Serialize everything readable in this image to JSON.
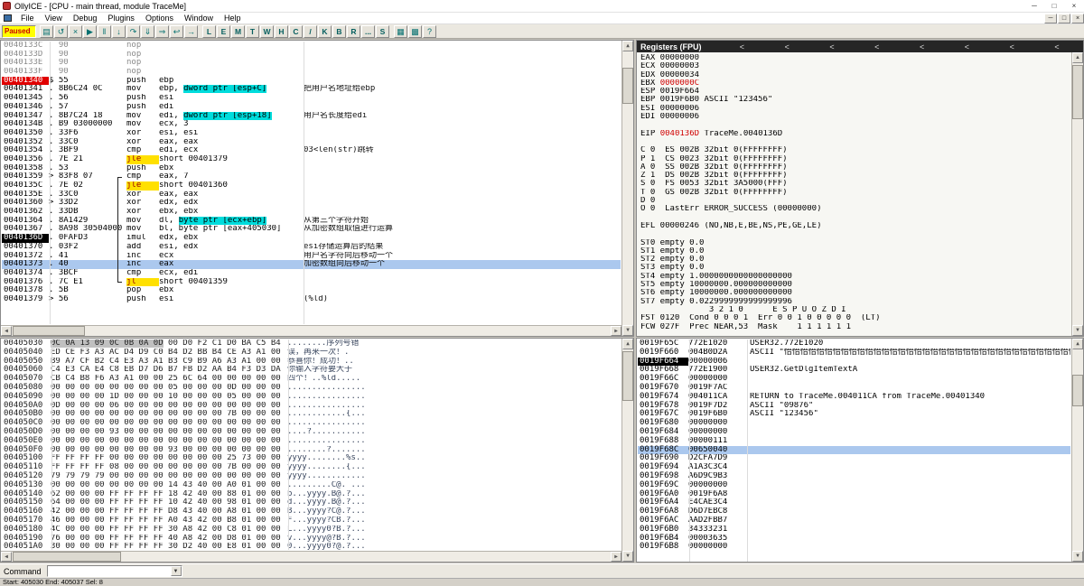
{
  "window": {
    "title": "OllyICE - [CPU - main thread, module TraceMe]",
    "controls": {
      "minimize": "─",
      "maximize": "□",
      "close": "×"
    },
    "mdi_controls": {
      "minimize": "─",
      "restore": "□",
      "close": "×"
    }
  },
  "menu": {
    "items": [
      "File",
      "View",
      "Debug",
      "Plugins",
      "Options",
      "Window",
      "Help"
    ]
  },
  "toolbar": {
    "status": "Paused",
    "icon_buttons": [
      {
        "name": "open-button",
        "glyph": "▤"
      },
      {
        "name": "restart-button",
        "glyph": "↺"
      },
      {
        "name": "close-process-button",
        "glyph": "×"
      },
      {
        "name": "run-button",
        "glyph": "▶"
      },
      {
        "name": "pause-button",
        "glyph": "‖"
      },
      {
        "name": "step-into-button",
        "glyph": "↓"
      },
      {
        "name": "step-over-button",
        "glyph": "↷"
      },
      {
        "name": "animate-into-button",
        "glyph": "⇓"
      },
      {
        "name": "animate-over-button",
        "glyph": "⇒"
      },
      {
        "name": "run-to-return-button",
        "glyph": "↩"
      },
      {
        "name": "goto-button",
        "glyph": "→"
      }
    ],
    "panel_buttons": [
      {
        "name": "log-window-button",
        "label": "L"
      },
      {
        "name": "executable-modules-button",
        "label": "E"
      },
      {
        "name": "memory-map-button",
        "label": "M"
      },
      {
        "name": "threads-button",
        "label": "T"
      },
      {
        "name": "windows-button",
        "label": "W"
      },
      {
        "name": "handles-button",
        "label": "H"
      },
      {
        "name": "cpu-window-button",
        "label": "C"
      },
      {
        "name": "patches-button",
        "label": "/"
      },
      {
        "name": "call-stack-button",
        "label": "K"
      },
      {
        "name": "breakpoints-button",
        "label": "B"
      },
      {
        "name": "references-button",
        "label": "R"
      },
      {
        "name": "run-trace-button",
        "label": "..."
      },
      {
        "name": "source-button",
        "label": "S"
      }
    ],
    "extra_buttons": [
      {
        "name": "options-button",
        "glyph": "▦"
      },
      {
        "name": "appearance-button",
        "glyph": "▩"
      },
      {
        "name": "help-button",
        "glyph": "?"
      }
    ]
  },
  "disasm": {
    "rows": [
      {
        "a": "0040133C",
        "p": "",
        "b": "90",
        "m": "nop",
        "dim": true
      },
      {
        "a": "0040133D",
        "p": "",
        "b": "90",
        "m": "nop",
        "dim": true
      },
      {
        "a": "0040133E",
        "p": "",
        "b": "90",
        "m": "nop",
        "dim": true
      },
      {
        "a": "0040133F",
        "p": "",
        "b": "90",
        "m": "nop",
        "dim": true
      },
      {
        "a": "00401340",
        "ac": "bp",
        "p": "$",
        "b": "55",
        "m": "push",
        "o": [
          [
            "ebp",
            ""
          ]
        ]
      },
      {
        "a": "00401341",
        "p": ".",
        "b": "8B6C24 0C",
        "m": "mov",
        "o": [
          [
            "ebp, ",
            ""
          ],
          [
            "dword ptr [esp+C]",
            "hl"
          ]
        ],
        "c": "把用户名地址给ebp"
      },
      {
        "a": "00401345",
        "p": ".",
        "b": "56",
        "m": "push",
        "o": [
          [
            "esi",
            ""
          ]
        ]
      },
      {
        "a": "00401346",
        "p": ".",
        "b": "57",
        "m": "push",
        "o": [
          [
            "edi",
            ""
          ]
        ]
      },
      {
        "a": "00401347",
        "p": ".",
        "b": "8B7C24 18",
        "m": "mov",
        "o": [
          [
            "edi, ",
            ""
          ],
          [
            "dword ptr [esp+18]",
            "hl"
          ]
        ],
        "c": "用户名长度给edi"
      },
      {
        "a": "0040134B",
        "p": ".",
        "b": "B9 03000000",
        "m": "mov",
        "o": [
          [
            "ecx, 3",
            ""
          ]
        ]
      },
      {
        "a": "00401350",
        "p": ".",
        "b": "33F6",
        "m": "xor",
        "o": [
          [
            "esi, esi",
            ""
          ]
        ]
      },
      {
        "a": "00401352",
        "p": ".",
        "b": "33C0",
        "m": "xor",
        "o": [
          [
            "eax, eax",
            ""
          ]
        ]
      },
      {
        "a": "00401354",
        "p": ".",
        "b": "3BF9",
        "m": "cmp",
        "o": [
          [
            "edi, ecx",
            ""
          ]
        ],
        "c": "03<len(str)跳转"
      },
      {
        "a": "00401356",
        "p": ".",
        "b": "7E 21",
        "m": "jle",
        "mc": "jmp",
        "o": [
          [
            "short 00401379",
            ""
          ]
        ]
      },
      {
        "a": "00401358",
        "p": ".",
        "b": "53",
        "m": "push",
        "o": [
          [
            "ebx",
            ""
          ]
        ]
      },
      {
        "a": "00401359",
        "p": ">",
        "b": "83F8 07",
        "m": "cmp",
        "o": [
          [
            "eax, 7",
            ""
          ]
        ]
      },
      {
        "a": "0040135C",
        "p": ".",
        "b": "7E 02",
        "m": "jle",
        "mc": "jmp",
        "o": [
          [
            "short 00401360",
            ""
          ]
        ]
      },
      {
        "a": "0040135E",
        "p": ".",
        "b": "33C0",
        "m": "xor",
        "o": [
          [
            "eax, eax",
            ""
          ]
        ]
      },
      {
        "a": "00401360",
        "p": ">",
        "b": "33D2",
        "m": "xor",
        "o": [
          [
            "edx, edx",
            ""
          ]
        ]
      },
      {
        "a": "00401362",
        "p": ".",
        "b": "33DB",
        "m": "xor",
        "o": [
          [
            "ebx, ebx",
            ""
          ]
        ]
      },
      {
        "a": "00401364",
        "p": ".",
        "b": "8A1429",
        "m": "mov",
        "o": [
          [
            "dl, ",
            ""
          ],
          [
            "byte ptr [ecx+ebp]",
            "hl"
          ]
        ],
        "c": "从第三个字符开始"
      },
      {
        "a": "00401367",
        "p": ".",
        "b": "8A98 30504000",
        "m": "mov",
        "o": [
          [
            "bl, byte ptr [eax+405030]",
            ""
          ]
        ],
        "c": "从加密数组取值进行运算"
      },
      {
        "a": "0040136D",
        "ac": "eip",
        "p": ".",
        "b": "0FAFD3",
        "m": "imul",
        "o": [
          [
            "edx, ebx",
            ""
          ]
        ]
      },
      {
        "a": "00401370",
        "p": ".",
        "b": "03F2",
        "m": "add",
        "o": [
          [
            "esi, edx",
            ""
          ]
        ],
        "c": "esi存储运算后的结果"
      },
      {
        "a": "00401372",
        "p": ".",
        "b": "41",
        "m": "inc",
        "o": [
          [
            "ecx",
            ""
          ]
        ],
        "c": "用户名字符向后移动一个"
      },
      {
        "a": "00401373",
        "p": ".",
        "b": "40",
        "m": "inc",
        "o": [
          [
            "eax",
            ""
          ]
        ],
        "c": "加密数组向后移动一个",
        "sel": true
      },
      {
        "a": "00401374",
        "p": ".",
        "b": "3BCF",
        "m": "cmp",
        "o": [
          [
            "ecx, edi",
            ""
          ]
        ]
      },
      {
        "a": "00401376",
        "p": ".",
        "b": "7C E1",
        "m": "jl",
        "mc": "jmp",
        "o": [
          [
            "short 00401359",
            ""
          ]
        ]
      },
      {
        "a": "00401378",
        "p": ".",
        "b": "5B",
        "m": "pop",
        "o": [
          [
            "ebx",
            ""
          ]
        ]
      },
      {
        "a": "00401379",
        "p": ">",
        "b": "56",
        "m": "push",
        "o": [
          [
            "esi",
            ""
          ]
        ],
        "c": "(%ld)"
      }
    ]
  },
  "registers": {
    "title": "Registers (FPU)",
    "chevrons": [
      "<",
      "<",
      "<",
      "<",
      "<",
      "<",
      "<",
      "<"
    ],
    "lines": [
      [
        [
          "EAX 00000000",
          ""
        ]
      ],
      [
        [
          "ECX 00000003",
          ""
        ]
      ],
      [
        [
          "EDX 00000034",
          ""
        ]
      ],
      [
        [
          "EBX ",
          ""
        ],
        [
          "0000000C",
          "r"
        ]
      ],
      [
        [
          "ESP 0019F664",
          ""
        ]
      ],
      [
        [
          "EBP 0019F6B0 ASCII \"123456\"",
          ""
        ]
      ],
      [
        [
          "ESI 00000006",
          ""
        ]
      ],
      [
        [
          "EDI 00000006",
          ""
        ]
      ],
      [
        [
          " ",
          ""
        ]
      ],
      [
        [
          "EIP ",
          ""
        ],
        [
          "0040136D",
          "r"
        ],
        [
          " TraceMe.0040136D",
          ""
        ]
      ],
      [
        [
          " ",
          ""
        ]
      ],
      [
        [
          "C 0  ES 002B 32bit 0(FFFFFFFF)",
          ""
        ]
      ],
      [
        [
          "P 1  CS 0023 32bit 0(FFFFFFFF)",
          ""
        ]
      ],
      [
        [
          "A 0  SS 002B 32bit 0(FFFFFFFF)",
          ""
        ]
      ],
      [
        [
          "Z 1  DS 002B 32bit 0(FFFFFFFF)",
          ""
        ]
      ],
      [
        [
          "S 0  FS 0053 32bit 3A5000(FFF)",
          ""
        ]
      ],
      [
        [
          "T 0  GS 002B 32bit 0(FFFFFFFF)",
          ""
        ]
      ],
      [
        [
          "D 0",
          ""
        ]
      ],
      [
        [
          "O 0  LastErr ERROR_SUCCESS (00000000)",
          ""
        ]
      ],
      [
        [
          " ",
          ""
        ]
      ],
      [
        [
          "EFL 00000246 (NO,NB,E,BE,NS,PE,GE,LE)",
          ""
        ]
      ],
      [
        [
          " ",
          ""
        ]
      ],
      [
        [
          "ST0 empty 0.0",
          ""
        ]
      ],
      [
        [
          "ST1 empty 0.0",
          ""
        ]
      ],
      [
        [
          "ST2 empty 0.0",
          ""
        ]
      ],
      [
        [
          "ST3 empty 0.0",
          ""
        ]
      ],
      [
        [
          "ST4 empty 1.0000000000000000000",
          ""
        ]
      ],
      [
        [
          "ST5 empty 10000000.000000000000",
          ""
        ]
      ],
      [
        [
          "ST6 empty 10000000.000000000000",
          ""
        ]
      ],
      [
        [
          "ST7 empty 0.0229999999999999996",
          ""
        ]
      ],
      [
        [
          "              3 2 1 0      E S P U O Z D I",
          ""
        ]
      ],
      [
        [
          "FST 0120  Cond 0 0 0 1  Err 0 0 1 0 0 0 0 0  (LT)",
          ""
        ]
      ],
      [
        [
          "FCW 027F  Prec NEAR,53  Mask    1 1 1 1 1 1",
          ""
        ]
      ]
    ]
  },
  "dump": {
    "rows": [
      {
        "a": "00405030",
        "hs": "0C 0A 13 09 0C 0B 0A 0D",
        "h": " 00 D0 F2 C1 D0 BA C5 B4",
        "t": "........序列号错"
      },
      {
        "a": "00405040",
        "h": "ED CE F3 A3 AC D4 D9 C0 B4 D2 BB B4 CE A3 A1 00",
        "t": "误，再来一次！."
      },
      {
        "a": "00405050",
        "h": "B9 A7 CF B2 C4 E3 A3 A1 B3 C9 B9 A6 A3 A1 00 00",
        "t": "恭喜你！成功！.."
      },
      {
        "a": "00405060",
        "h": "C4 E3 CA E4 C8 EB D7 D6 B7 FB D2 AA B4 F3 D3 DA",
        "t": "你输入字符要大于"
      },
      {
        "a": "00405070",
        "h": "CB C4 B8 F6 A3 A1 00 00 25 6C 64 00 00 00 00 00",
        "t": "四个！..%ld....."
      },
      {
        "a": "00405080",
        "h": "00 00 00 00 00 00 00 00 05 00 00 00 0D 00 00 00",
        "t": "................"
      },
      {
        "a": "00405090",
        "h": "00 00 00 00 1D 00 00 00 10 00 00 00 05 00 00 00",
        "t": "................"
      },
      {
        "a": "004050A0",
        "h": "0D 00 00 00 06 00 00 00 00 00 00 00 00 00 00 00",
        "t": "................"
      },
      {
        "a": "004050B0",
        "h": "00 00 00 00 00 00 00 00 00 00 00 00 7B 00 00 00",
        "t": "............{..."
      },
      {
        "a": "004050C0",
        "h": "00 00 00 00 00 00 00 00 00 00 00 00 00 00 00 00",
        "t": "................"
      },
      {
        "a": "004050D0",
        "h": "00 00 00 00 93 00 00 00 00 00 00 00 00 00 00 00",
        "t": "....?..........."
      },
      {
        "a": "004050E0",
        "h": "00 00 00 00 00 00 00 00 00 00 00 00 00 00 00 00",
        "t": "................"
      },
      {
        "a": "004050F0",
        "h": "00 00 00 00 00 00 00 00 93 00 00 00 00 00 00 00",
        "t": "........?......."
      },
      {
        "a": "00405100",
        "h": "FF FF FF FF 00 00 00 00 00 00 00 00 25 73 00 00",
        "t": "ÿÿÿÿ........%s.."
      },
      {
        "a": "00405110",
        "h": "FF FF FF FF 08 00 00 00 00 00 00 00 7B 00 00 00",
        "t": "ÿÿÿÿ........{..."
      },
      {
        "a": "00405120",
        "h": "79 79 79 79 00 00 00 00 00 00 00 00 00 00 00 00",
        "t": "yyyy............"
      },
      {
        "a": "00405130",
        "h": "00 00 00 00 00 00 00 00 14 43 40 00 A0 01 00 00",
        "t": ".........C@. ..."
      },
      {
        "a": "00405140",
        "h": "62 00 00 00 FF FF FF FF 18 42 40 00 88 01 00 00",
        "t": "b...ÿÿÿÿ.B@.?..."
      },
      {
        "a": "00405150",
        "h": "64 00 00 00 FF FF FF FF 10 42 40 00 98 01 00 00",
        "t": "d...ÿÿÿÿ.B@.?..."
      },
      {
        "a": "00405160",
        "h": "42 00 00 00 FF FF FF FF D8 43 40 00 A8 01 00 00",
        "t": "B...ÿÿÿÿ?C@.?..."
      },
      {
        "a": "00405170",
        "h": "46 00 00 00 FF FF FF FF A0 43 42 00 B8 01 00 00",
        "t": "F...ÿÿÿÿ?CB.?..."
      },
      {
        "a": "00405180",
        "h": "4C 00 00 00 FF FF FF FF 30 A8 42 00 C8 01 00 00",
        "t": "L...ÿÿÿÿ0?B.?..."
      },
      {
        "a": "00405190",
        "h": "76 00 00 00 FF FF FF FF 40 A8 42 00 D8 01 00 00",
        "t": "v...ÿÿÿÿ@?B.?..."
      },
      {
        "a": "004051A0",
        "h": "30 00 00 00 FF FF FF FF 30 D2 40 00 E8 01 00 00",
        "t": "0...ÿÿÿÿ0?@.?..."
      }
    ]
  },
  "stack": {
    "rows": [
      {
        "a": "0019F65C",
        "v": "772E1020",
        "c": "USER32.772E1020"
      },
      {
        "a": "0019F660",
        "v": "004B0D2A",
        "c": "ASCII \"恰恰恰恰恰恰恰恰恰恰恰恰恰恰恰恰恰恰恰恰恰恰恰恰恰恰恰恰恰恰恰恰恰恰恰恰恰恰\""
      },
      {
        "a": "0019F664",
        "ac": "esp",
        "v": "00000006"
      },
      {
        "a": "0019F668",
        "v": "772E1900",
        "c": "USER32.GetDlgItemTextA"
      },
      {
        "a": "0019F66C",
        "v": "00000000"
      },
      {
        "a": "0019F670",
        "v": "0019F7AC"
      },
      {
        "a": "0019F674",
        "v": "004011CA",
        "c": "RETURN to TraceMe.004011CA from TraceMe.00401340"
      },
      {
        "a": "0019F678",
        "v": "0019F7D2",
        "c": "ASCII \"09876\""
      },
      {
        "a": "0019F67C",
        "v": "0019F6B0",
        "c": "ASCII \"123456\""
      },
      {
        "a": "0019F680",
        "v": "00000000"
      },
      {
        "a": "0019F684",
        "v": "00000000"
      },
      {
        "a": "0019F688",
        "v": "00000111"
      },
      {
        "a": "0019F68C",
        "v": "00650040",
        "sel": true
      },
      {
        "a": "0019F690",
        "v": "D2CFA7D9"
      },
      {
        "a": "0019F694",
        "v": "A1A3C3C4"
      },
      {
        "a": "0019F698",
        "v": "A6D9C9B3"
      },
      {
        "a": "0019F69C",
        "v": "00000000"
      },
      {
        "a": "0019F6A0",
        "v": "0019F6A8"
      },
      {
        "a": "0019F6A4",
        "v": "E4CAE3C4"
      },
      {
        "a": "0019F6A8",
        "v": "D6D7EBC8"
      },
      {
        "a": "0019F6AC",
        "v": "AAD2FBB7"
      },
      {
        "a": "0019F6B0",
        "v": "34333231"
      },
      {
        "a": "0019F6B4",
        "v": "00003635"
      },
      {
        "a": "0019F6B8",
        "v": "00000000"
      }
    ]
  },
  "command_bar": {
    "label": "Command"
  },
  "status_bar": {
    "left": "Start: 405030  End: 405037  Sel: 8"
  }
}
